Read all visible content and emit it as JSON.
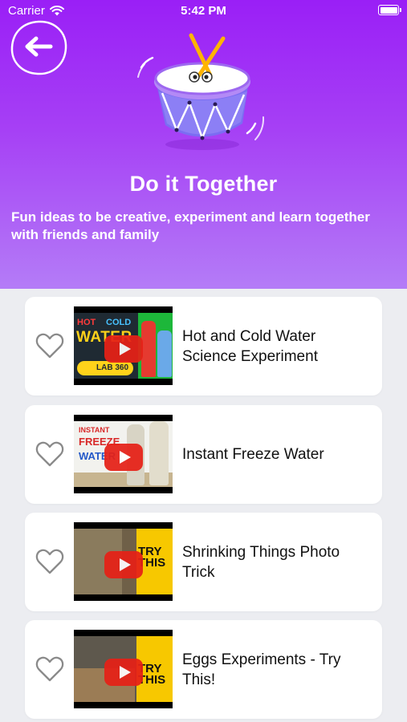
{
  "status_bar": {
    "carrier": "Carrier",
    "time": "5:42 PM"
  },
  "header": {
    "title": "Do it Together",
    "subtitle": "Fun ideas to be creative, experiment and learn together with friends and family",
    "gradient_top": "#9a1ff6",
    "gradient_bottom": "#b47cf7"
  },
  "icons": {
    "back": "back-arrow-icon",
    "drum": "drum-illustration",
    "favorite": "heart-outline-icon",
    "play": "play-icon"
  },
  "videos": [
    {
      "title": "Hot and Cold Water Science Experiment",
      "thumb_text": {
        "hot": "HOT",
        "cold": "COLD",
        "water": "WATER",
        "lab": "LAB 360"
      }
    },
    {
      "title": "Instant Freeze Water",
      "thumb_text": {
        "line1": "INSTANT",
        "line2": "FREEZE",
        "line3": "WATER"
      }
    },
    {
      "title": "Shrinking Things Photo Trick",
      "thumb_text": {
        "line1": "TRY THIS"
      }
    },
    {
      "title": "Eggs Experiments - Try This!",
      "thumb_text": {
        "line1": "TRY THIS"
      }
    }
  ]
}
